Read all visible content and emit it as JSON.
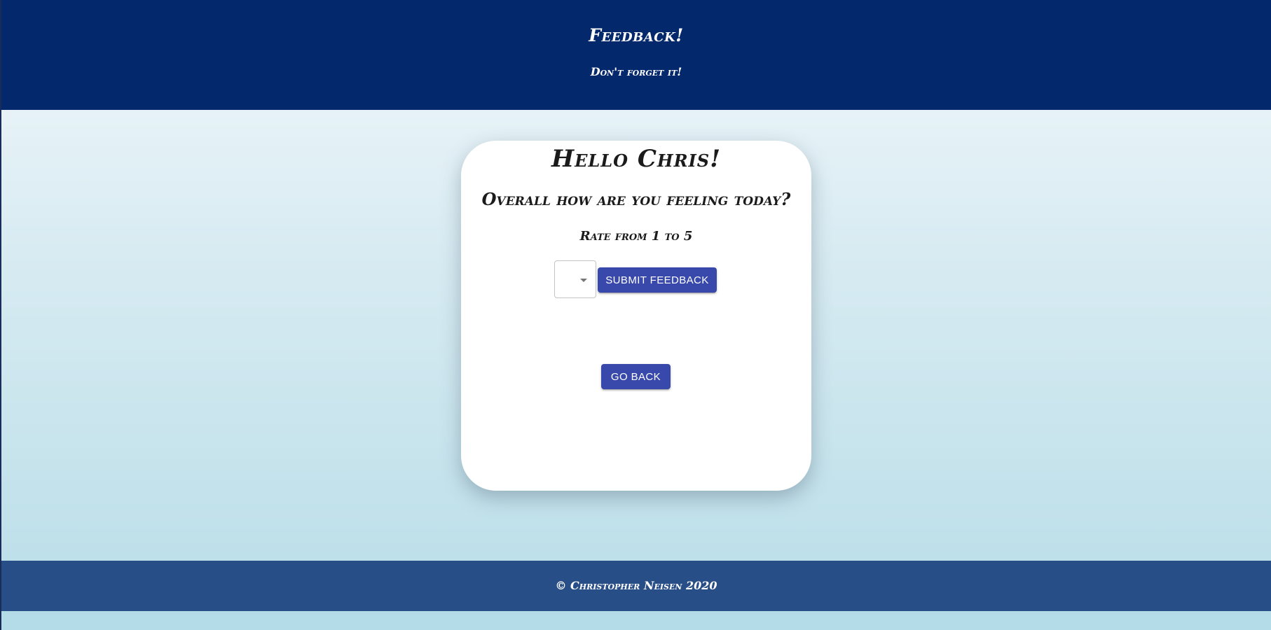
{
  "header": {
    "title": "Feedback!",
    "subtitle": "Don't forget it!"
  },
  "card": {
    "greeting": "Hello Chris!",
    "question": "Overall how are you feeling today?",
    "rate_label": "Rate from 1 to 5",
    "rating_select": {
      "selected_value": "",
      "icon": "chevron-down-icon"
    },
    "submit_label": "Submit Feedback",
    "back_label": "Go Back"
  },
  "footer": {
    "text": "© Christopher Neisen 2020"
  },
  "colors": {
    "header_bg": "#03286b",
    "footer_bg": "#284e87",
    "button_bg": "#3949ab",
    "card_bg": "#ffffff"
  }
}
